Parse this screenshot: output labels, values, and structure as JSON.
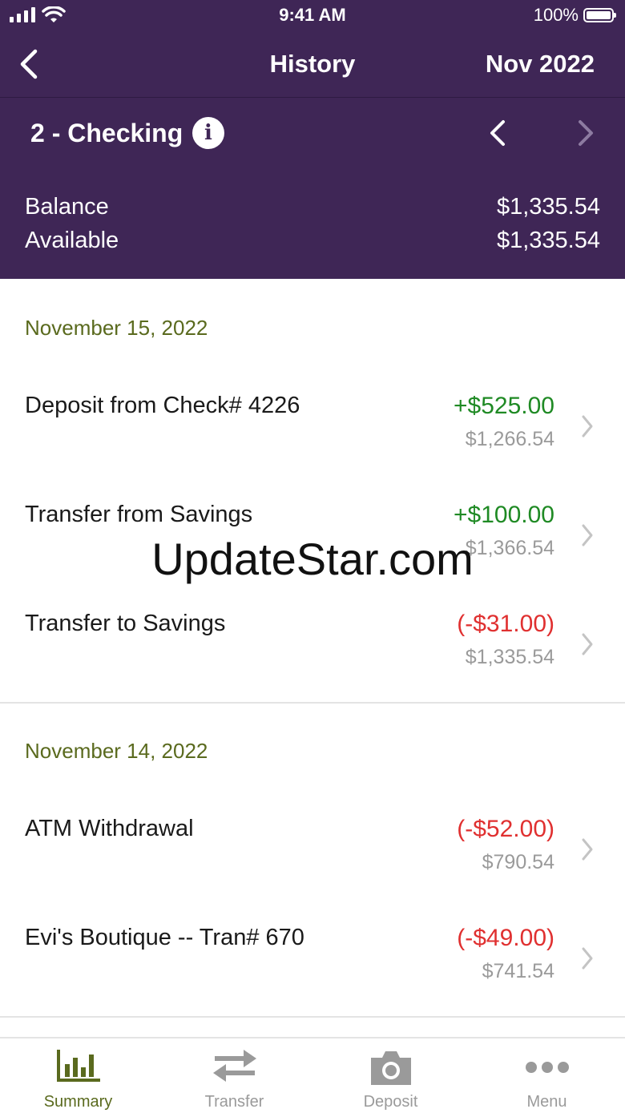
{
  "status_bar": {
    "time": "9:41 AM",
    "battery": "100%"
  },
  "nav": {
    "title": "History",
    "month": "Nov 2022"
  },
  "account": {
    "name": "2 - Checking",
    "balance_label": "Balance",
    "balance_value": "$1,335.54",
    "available_label": "Available",
    "available_value": "$1,335.54"
  },
  "groups": [
    {
      "date": "November 15, 2022",
      "transactions": [
        {
          "description": "Deposit from Check# 4226",
          "amount": "+$525.00",
          "balance": "$1,266.54",
          "type": "credit"
        },
        {
          "description": "Transfer from Savings",
          "amount": "+$100.00",
          "balance": "$1,366.54",
          "type": "credit"
        },
        {
          "description": "Transfer to Savings",
          "amount": "(-$31.00)",
          "balance": "$1,335.54",
          "type": "debit"
        }
      ]
    },
    {
      "date": "November 14, 2022",
      "transactions": [
        {
          "description": "ATM Withdrawal",
          "amount": "(-$52.00)",
          "balance": "$790.54",
          "type": "debit"
        },
        {
          "description": "Evi's Boutique -- Tran# 670",
          "amount": "(-$49.00)",
          "balance": "$741.54",
          "type": "debit"
        }
      ]
    }
  ],
  "tabs": [
    {
      "label": "Summary",
      "icon": "bar-chart-icon",
      "active": true
    },
    {
      "label": "Transfer",
      "icon": "transfer-arrows-icon",
      "active": false
    },
    {
      "label": "Deposit",
      "icon": "camera-icon",
      "active": false
    },
    {
      "label": "Menu",
      "icon": "more-dots-icon",
      "active": false
    }
  ],
  "watermark": "UpdateStar.com",
  "colors": {
    "header_bg": "#3f2656",
    "credit": "#1f8a24",
    "debit": "#e03030",
    "date_header": "#5a6a1e",
    "active_tab": "#5a6a1e",
    "inactive_tab": "#9a9a9a"
  }
}
